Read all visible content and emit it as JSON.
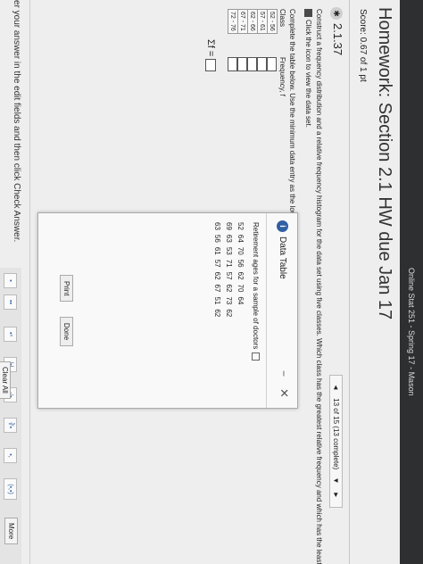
{
  "topbar": {
    "course": "Online Stat 251 - Spring 17 - Mason"
  },
  "title": "Homework: Section 2.1 HW due Jan 17",
  "score": "Score: 0.67 of 1 pt",
  "question": {
    "number": "2.1.37",
    "nav_prev": "◄",
    "nav_text": "13 of 15 (13 complete)",
    "nav_dropdown": "▼",
    "nav_next": "►",
    "instruction": "Construct a frequency distribution and a relative frequency histogram for the data set using five classes. Which class has the greatest relative frequency and which has the least relative frequency?",
    "icon_hint": "Click the icon to view the data set.",
    "complete_prompt": "Complete the table below. Use the minimum data entry as the lower limit of the first class.",
    "class_header": "Class",
    "frequency_header": "Frequency, f",
    "classes": [
      "52 - 56",
      "57 - 61",
      "62 - 66",
      "67 - 71",
      "72 - 76"
    ],
    "sigma_label": "Σf ="
  },
  "dialog": {
    "icon": "i",
    "title": "Data Table",
    "minimize": "−",
    "close": "✕",
    "data_title": "Retirement ages for a sample of doctors",
    "ages": [
      [
        "52",
        "64",
        "70",
        "56",
        "62",
        "70",
        "64"
      ],
      [
        "69",
        "63",
        "53",
        "71",
        "57",
        "62",
        "73",
        "62"
      ],
      [
        "63",
        "56",
        "61",
        "57",
        "62",
        "67",
        "51",
        "62"
      ]
    ],
    "print_label": "Print",
    "done_label": "Done"
  },
  "bottom_text": "er your answer in the edit fields and then click Check Answer.",
  "toolbar": {
    "tools": [
      "▪",
      "▪▪",
      "▪ⁿ",
      "|▪|",
      "√▪",
      "∛▪",
      "▪,",
      "(▪,▪)"
    ],
    "more_label": "More"
  },
  "clear_all_label": "Clear All"
}
